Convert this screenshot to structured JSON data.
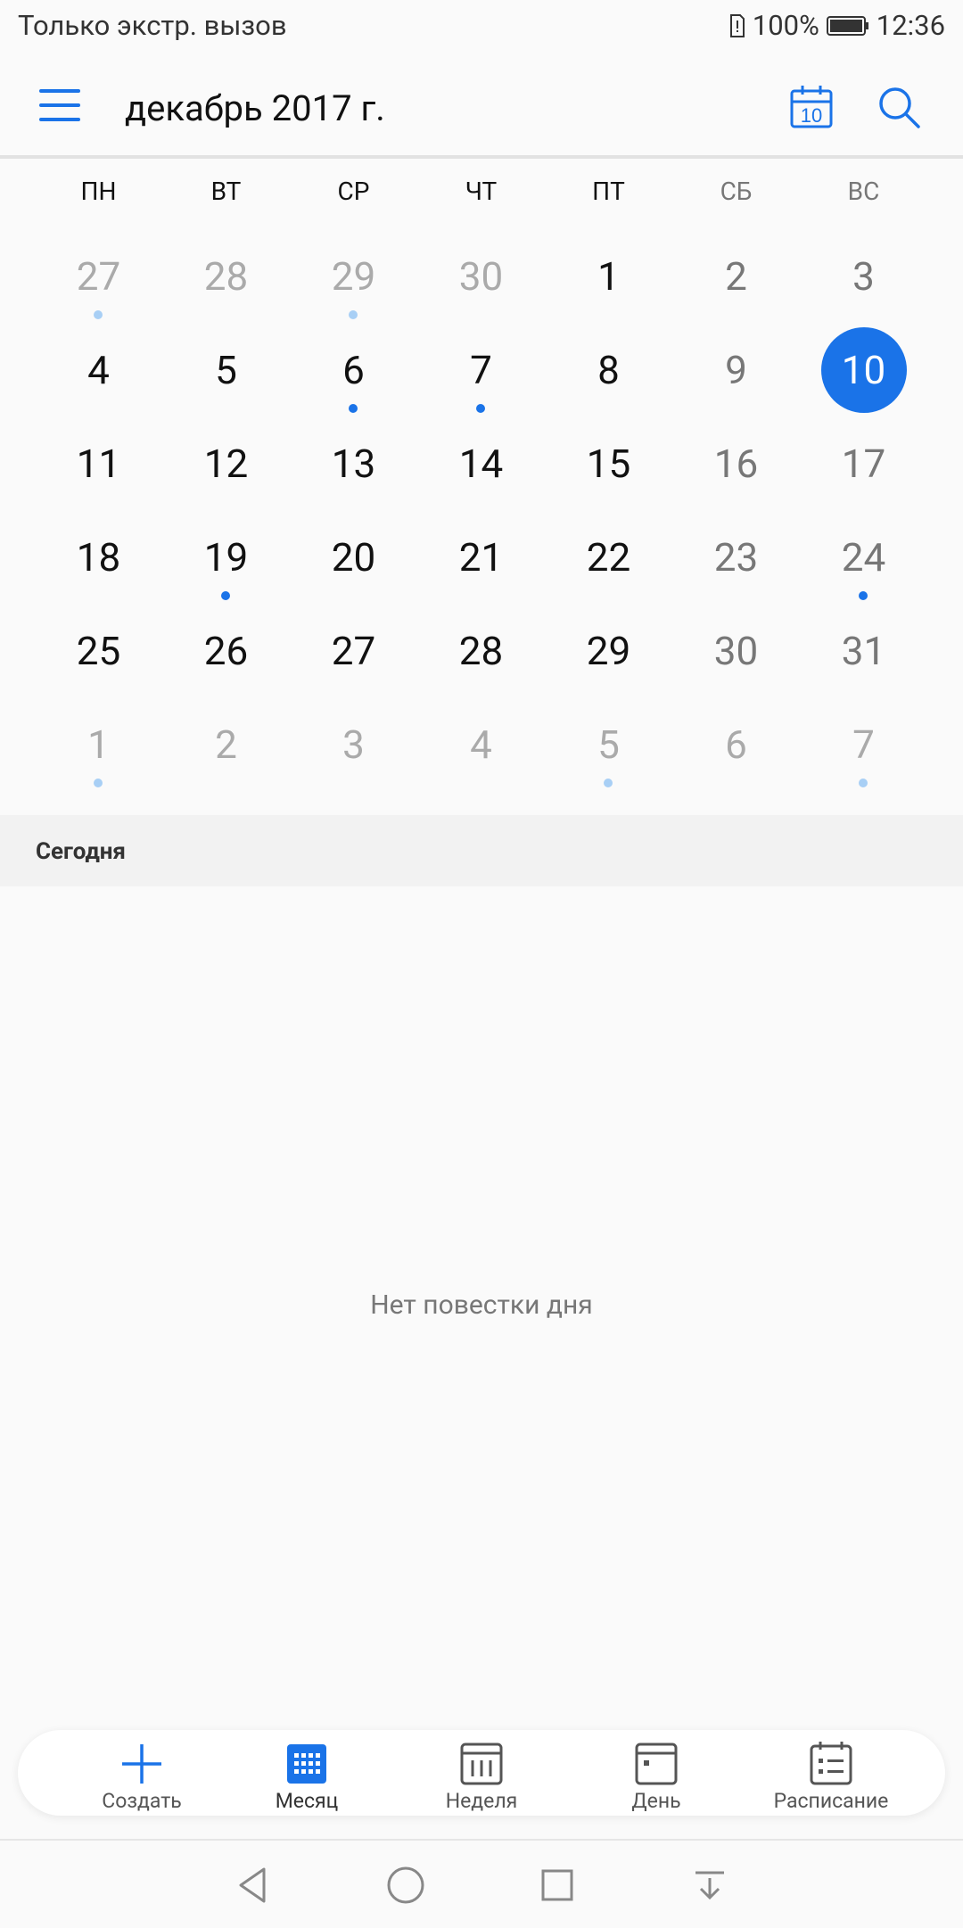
{
  "status_bar": {
    "left_text": "Только экстр. вызов",
    "battery": "100%",
    "time": "12:36"
  },
  "header": {
    "title": "декабрь 2017 г.",
    "today_icon_number": "10"
  },
  "weekdays": [
    "ПН",
    "ВТ",
    "СР",
    "ЧТ",
    "ПТ",
    "СБ",
    "ВС"
  ],
  "weeks": [
    [
      {
        "n": "27",
        "muted": true,
        "dot": "light"
      },
      {
        "n": "28",
        "muted": true
      },
      {
        "n": "29",
        "muted": true,
        "dot": "light"
      },
      {
        "n": "30",
        "muted": true
      },
      {
        "n": "1"
      },
      {
        "n": "2",
        "weekend": true
      },
      {
        "n": "3",
        "weekend": true
      }
    ],
    [
      {
        "n": "4"
      },
      {
        "n": "5"
      },
      {
        "n": "6",
        "dot": "solid"
      },
      {
        "n": "7",
        "dot": "solid"
      },
      {
        "n": "8"
      },
      {
        "n": "9",
        "weekend": true
      },
      {
        "n": "10",
        "selected": true
      }
    ],
    [
      {
        "n": "11"
      },
      {
        "n": "12"
      },
      {
        "n": "13"
      },
      {
        "n": "14"
      },
      {
        "n": "15"
      },
      {
        "n": "16",
        "weekend": true
      },
      {
        "n": "17",
        "weekend": true
      }
    ],
    [
      {
        "n": "18"
      },
      {
        "n": "19",
        "dot": "solid"
      },
      {
        "n": "20"
      },
      {
        "n": "21"
      },
      {
        "n": "22"
      },
      {
        "n": "23",
        "weekend": true
      },
      {
        "n": "24",
        "weekend": true,
        "dot": "solid"
      }
    ],
    [
      {
        "n": "25"
      },
      {
        "n": "26"
      },
      {
        "n": "27"
      },
      {
        "n": "28"
      },
      {
        "n": "29"
      },
      {
        "n": "30",
        "weekend": true
      },
      {
        "n": "31",
        "weekend": true
      }
    ],
    [
      {
        "n": "1",
        "muted": true,
        "dot": "light"
      },
      {
        "n": "2",
        "muted": true
      },
      {
        "n": "3",
        "muted": true
      },
      {
        "n": "4",
        "muted": true
      },
      {
        "n": "5",
        "muted": true,
        "dot": "light"
      },
      {
        "n": "6",
        "muted": true
      },
      {
        "n": "7",
        "muted": true,
        "dot": "light"
      }
    ]
  ],
  "agenda": {
    "section_label": "Сегодня",
    "empty_text": "Нет повестки дня"
  },
  "bottom_nav": [
    {
      "label": "Создать",
      "icon": "plus-icon"
    },
    {
      "label": "Месяц",
      "icon": "month-grid-icon",
      "active": true
    },
    {
      "label": "Неделя",
      "icon": "week-icon"
    },
    {
      "label": "День",
      "icon": "day-icon"
    },
    {
      "label": "Расписание",
      "icon": "schedule-icon"
    }
  ],
  "colors": {
    "accent": "#1a73e8",
    "muted": "#aaaaaa",
    "weekend": "#777777",
    "text": "#111111"
  }
}
